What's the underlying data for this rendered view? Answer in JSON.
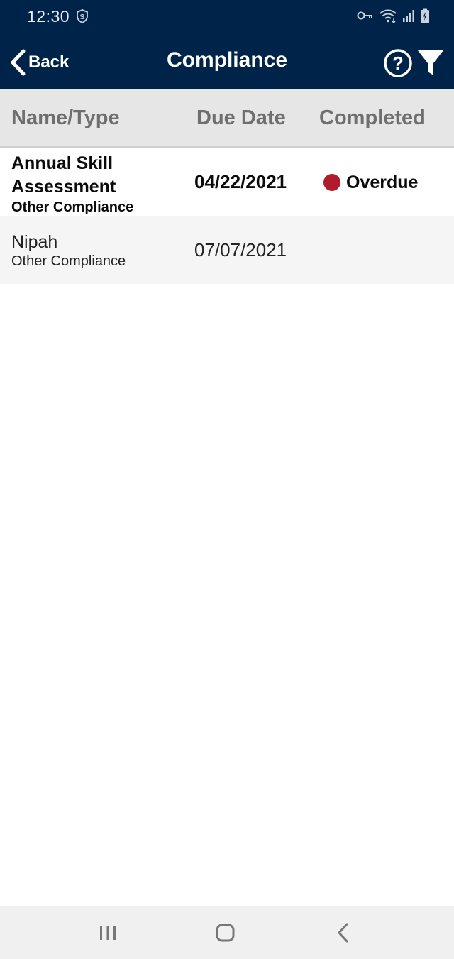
{
  "status_bar": {
    "time": "12:30"
  },
  "header": {
    "back_label": "Back",
    "title": "Compliance"
  },
  "table": {
    "columns": [
      "Name/Type",
      "Due Date",
      "Completed"
    ],
    "rows": [
      {
        "name": "Annual Skill Assessment",
        "type": "Other Compliance",
        "due_date": "04/22/2021",
        "completed": "Overdue",
        "status_color": "#b01c2e"
      },
      {
        "name": "Nipah",
        "type": "Other Compliance",
        "due_date": "07/07/2021",
        "completed": ""
      }
    ]
  },
  "colors": {
    "header_bg": "#00234a",
    "overdue": "#b01c2e"
  }
}
